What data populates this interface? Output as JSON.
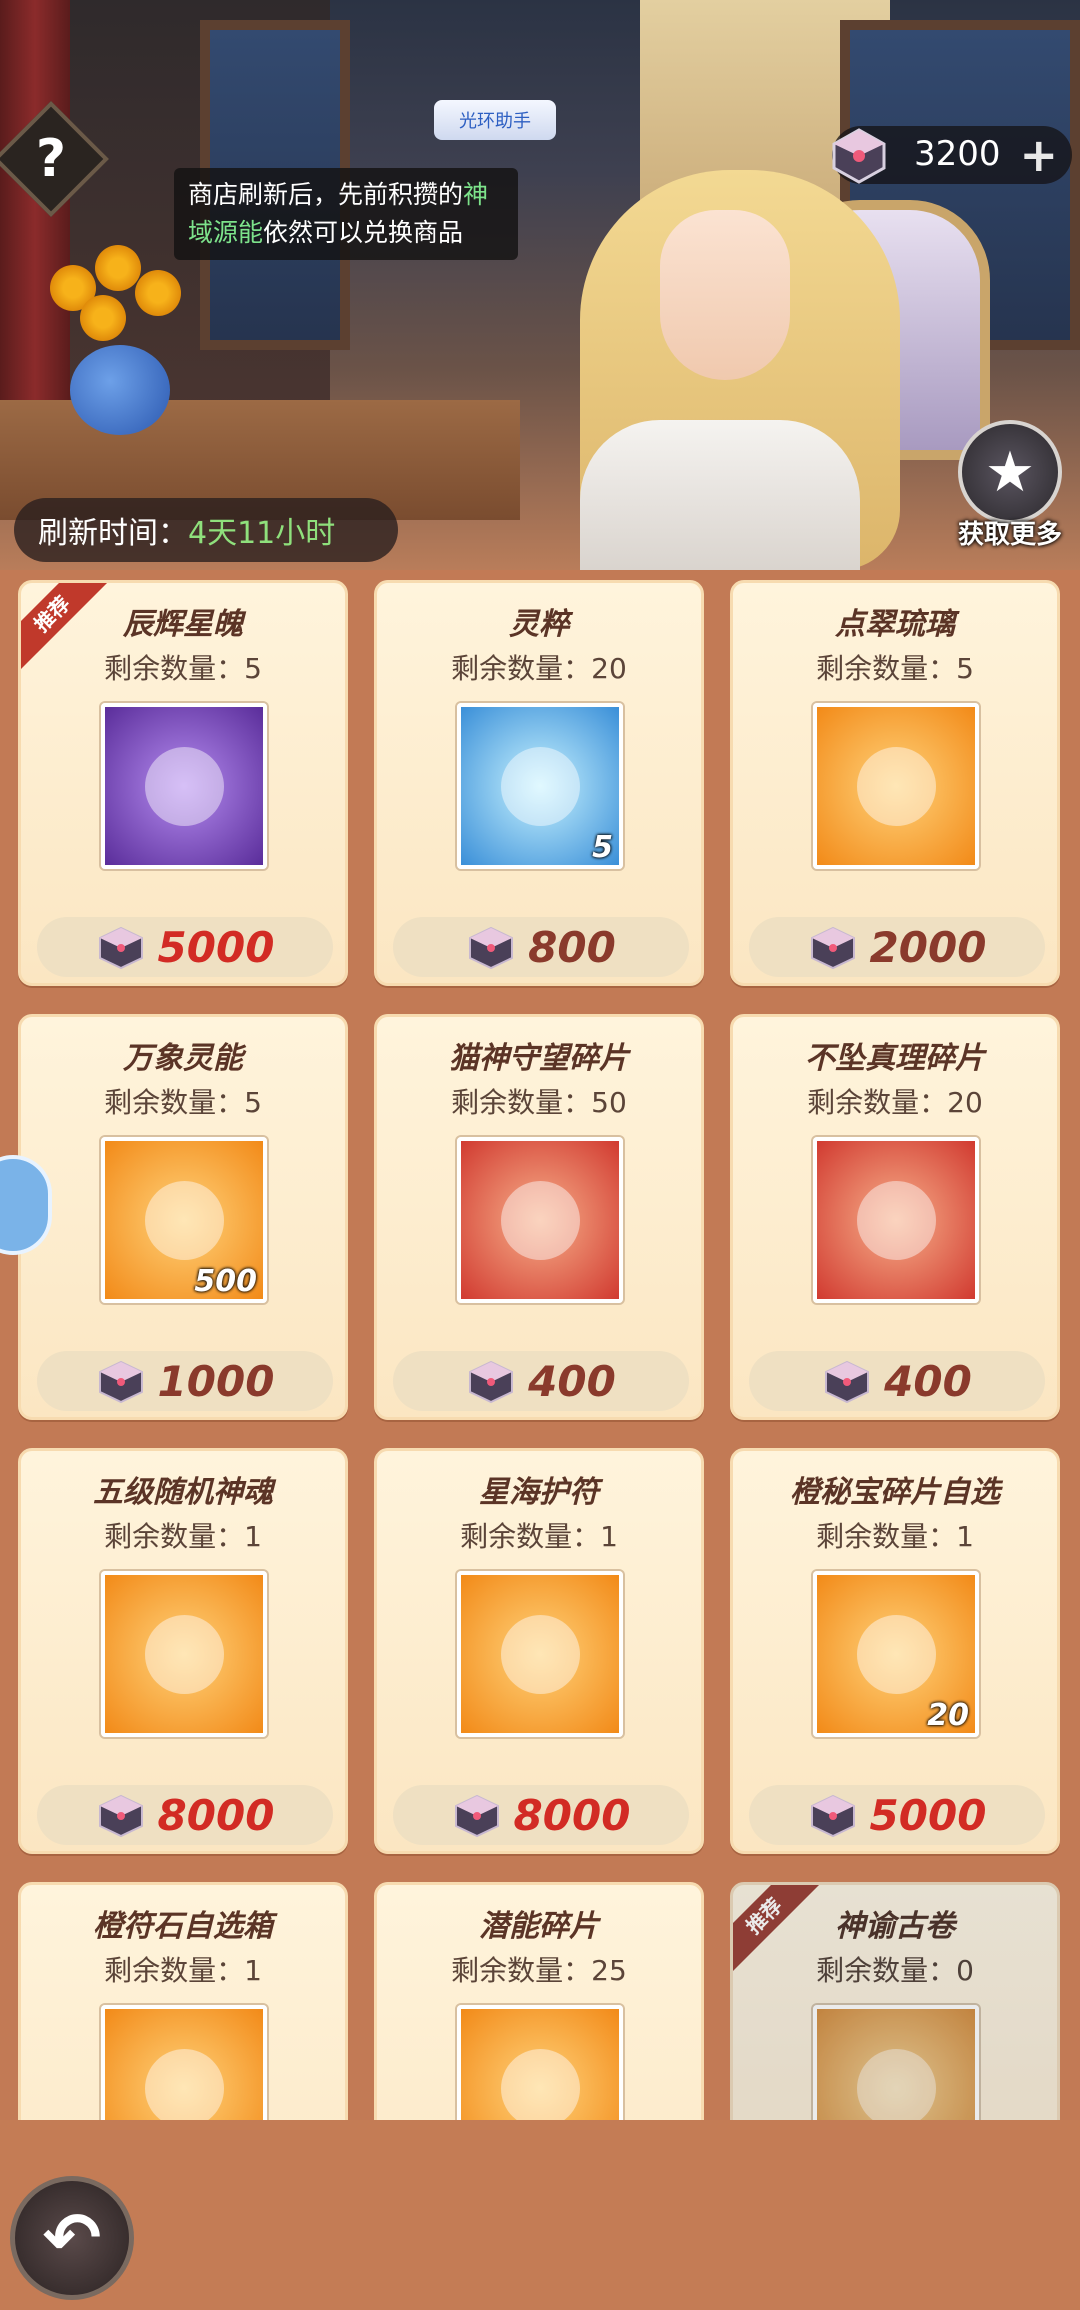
{
  "header": {
    "help_icon": "question-icon",
    "tooltip": {
      "part1": "商店刷新后，先前积攒的",
      "highlight": "神域源能",
      "part2": "依然可以兑换商品"
    },
    "assistant_label": "光环助手",
    "currency": {
      "icon": "gem-chest-icon",
      "amount": "3200",
      "plus": "+"
    },
    "get_more": {
      "icon": "star-icon",
      "label": "获取更多"
    },
    "refresh": {
      "label": "刷新时间：",
      "value": "4天11小时"
    }
  },
  "colors": {
    "price_red": "#d22b24",
    "price_brown": "#8a3a2c",
    "highlight_green": "#7de38b"
  },
  "shop": {
    "items": [
      {
        "name": "辰辉星魄",
        "remaining": "剩余数量：5",
        "price": "5000",
        "badge": "推荐",
        "count": ""
      },
      {
        "name": "灵粹",
        "remaining": "剩余数量：20",
        "price": "800",
        "badge": "",
        "count": "5"
      },
      {
        "name": "点翠琉璃",
        "remaining": "剩余数量：5",
        "price": "2000",
        "badge": "",
        "count": ""
      },
      {
        "name": "万象灵能",
        "remaining": "剩余数量：5",
        "price": "1000",
        "badge": "",
        "count": "500"
      },
      {
        "name": "猫神守望碎片",
        "remaining": "剩余数量：50",
        "price": "400",
        "badge": "",
        "count": ""
      },
      {
        "name": "不坠真理碎片",
        "remaining": "剩余数量：20",
        "price": "400",
        "badge": "",
        "count": ""
      },
      {
        "name": "五级随机神魂",
        "remaining": "剩余数量：1",
        "price": "8000",
        "badge": "",
        "count": ""
      },
      {
        "name": "星海护符",
        "remaining": "剩余数量：1",
        "price": "8000",
        "badge": "",
        "count": ""
      },
      {
        "name": "橙秘宝碎片自选",
        "remaining": "剩余数量：1",
        "price": "5000",
        "badge": "",
        "count": "20"
      },
      {
        "name": "橙符石自选箱",
        "remaining": "剩余数量：1",
        "price": "",
        "badge": "",
        "count": ""
      },
      {
        "name": "潜能碎片",
        "remaining": "剩余数量：25",
        "price": "",
        "badge": "",
        "count": ""
      },
      {
        "name": "神谕古卷",
        "remaining": "剩余数量：0",
        "price": "",
        "badge": "推荐",
        "count": ""
      }
    ]
  },
  "footer": {
    "back_icon": "back-arrow-icon",
    "back_glyph": "↶"
  }
}
